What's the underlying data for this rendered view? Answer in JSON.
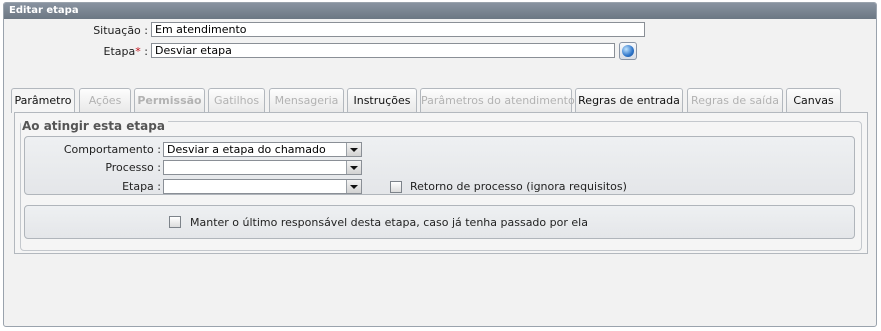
{
  "window": {
    "title": "Editar etapa"
  },
  "form": {
    "situacao": {
      "label": "Situação :",
      "value": "Em atendimento"
    },
    "etapa": {
      "label": "Etapa",
      "required_mark": "*",
      "colon": ":",
      "value": "Desviar etapa"
    },
    "icon": "globe-icon"
  },
  "tabs": [
    {
      "label": "Parâmetro",
      "enabled": true,
      "active": true
    },
    {
      "label": "Ações",
      "enabled": false
    },
    {
      "label": "Permissão",
      "enabled": false
    },
    {
      "label": "Gatilhos",
      "enabled": false
    },
    {
      "label": "Mensageria",
      "enabled": false
    },
    {
      "label": "Instruções",
      "enabled": true
    },
    {
      "label": "Parâmetros do atendimento",
      "enabled": false
    },
    {
      "label": "Regras de entrada",
      "enabled": true
    },
    {
      "label": "Regras de saída",
      "enabled": false
    },
    {
      "label": "Canvas",
      "enabled": true
    }
  ],
  "panel": {
    "legend": "Ao atingir esta etapa",
    "comportamento": {
      "label": "Comportamento :",
      "value": "Desviar a etapa do chamado"
    },
    "processo": {
      "label": "Processo :",
      "value": ""
    },
    "etapa": {
      "label": "Etapa :",
      "value": ""
    },
    "retorno": {
      "label": "Retorno de processo (ignora requisitos)",
      "checked": false
    },
    "manter": {
      "label": "Manter o último responsável desta etapa, caso já tenha passado por ela",
      "checked": false
    }
  },
  "colors": {
    "titlebar": "#7a8591",
    "required": "#c0131b",
    "disabled_tab_text": "#b2b2b2"
  }
}
